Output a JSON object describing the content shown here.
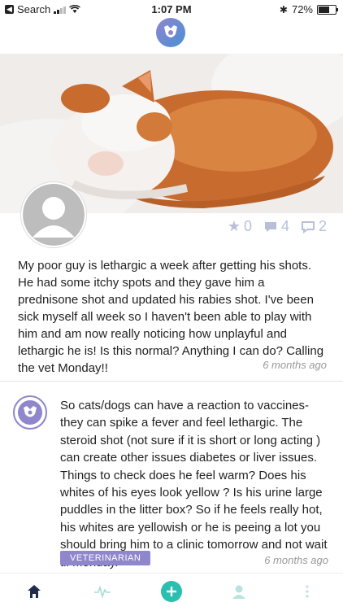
{
  "status_bar": {
    "back_label": "Search",
    "time": "1:07 PM",
    "battery": "72%",
    "battery_level": 0.72
  },
  "post": {
    "stats": {
      "stars": "0",
      "comments": "4",
      "replies": "2"
    },
    "text": "My poor guy is lethargic a week after getting his shots. He had some itchy spots and they gave him a prednisone shot and updated his rabies shot. I've been sick myself all week so I haven't been able to play with him and am now really noticing how unplayful and lethargic he is! Is this normal? Anything I can do? Calling the vet Monday!!",
    "time": "6 months ago"
  },
  "reply": {
    "text": "So cats/dogs can have a reaction to vaccines- they can spike a fever and feel lethargic. The steroid shot (not sure if it is short or long acting ) can create other issues diabetes or liver issues. Things to check does he feel warm? Does his whites of his eyes look yellow ? Is his urine large puddles in the litter box? So if he feels really hot, his whites are yellowish or he is peeing a lot you should bring him to a clinic tomorrow and not wait til Monday.",
    "badge": "VETERINARIAN",
    "time": "6 months ago"
  },
  "colors": {
    "brand_purple": "#8f86cc",
    "brand_blue": "#4a8fd6",
    "teal": "#2bbfb0",
    "nav_dark": "#1f2d4a",
    "icon_muted": "#b9bfd8"
  },
  "tab_bar": {
    "items": [
      "home-icon",
      "health-pulse-icon",
      "add-icon",
      "profile-icon",
      "more-icon"
    ]
  }
}
